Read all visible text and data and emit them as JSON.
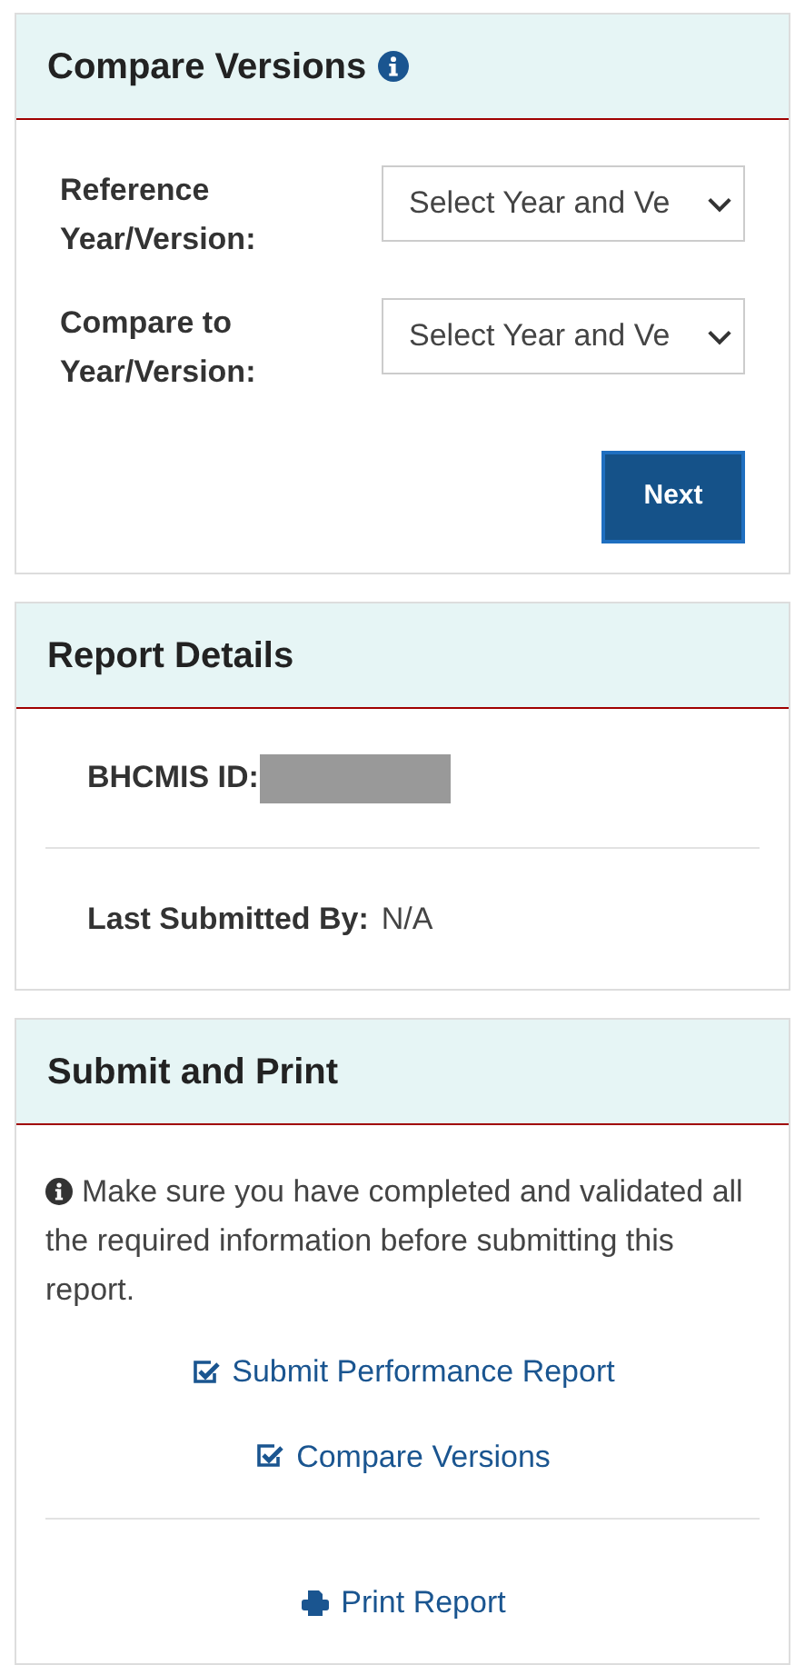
{
  "compare_panel": {
    "title": "Compare Versions",
    "fields": [
      {
        "label": "Reference Year/Version:",
        "value": "Select Year and Ve"
      },
      {
        "label": "Compare to Year/Version:",
        "value": "Select Year and Ve"
      }
    ],
    "button": "Next"
  },
  "report_details": {
    "title": "Report Details",
    "rows": [
      {
        "label": "BHCMIS ID:",
        "kind": "redacted"
      },
      {
        "label": "Last Submitted By:",
        "value": "N/A",
        "kind": "text"
      }
    ]
  },
  "submit_panel": {
    "title": "Submit and Print",
    "notice": "Make sure you have completed and validated all the required information before submitting this report.",
    "actions": [
      {
        "label": "Submit Performance Report",
        "kind": "check"
      },
      {
        "label": "Compare Versions",
        "kind": "check"
      }
    ],
    "print": {
      "label": "Print Report",
      "kind": "print"
    }
  }
}
